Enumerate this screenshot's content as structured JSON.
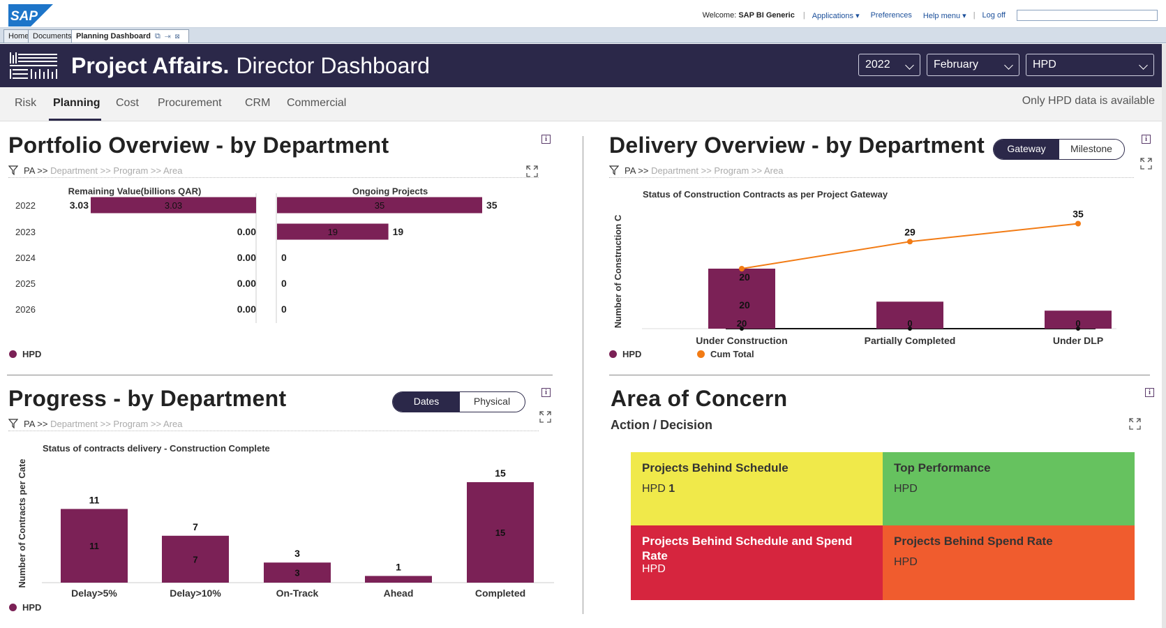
{
  "portal": {
    "logo_text": "SAP",
    "welcome_prefix": "Welcome:",
    "user": "SAP BI Generic",
    "links": [
      "Applications",
      "Preferences",
      "Help menu",
      "Log off"
    ],
    "tabs": [
      "Home",
      "Documents",
      "Planning Dashboard"
    ]
  },
  "header": {
    "title_bold": "Project Affairs.",
    "title_light": "Director Dashboard",
    "year": "2022",
    "month": "February",
    "department": "HPD"
  },
  "nav": {
    "items": [
      "Risk",
      "Planning",
      "Cost",
      "Procurement",
      "CRM",
      "Commercial"
    ],
    "active": "Planning",
    "note": "Only HPD data is available"
  },
  "crumb": {
    "pa": "PA >>",
    "rest": "Department >> Program >> Area"
  },
  "colors": {
    "brand": "#2b2849",
    "bar": "#7b2156",
    "line": "#f27b14",
    "yellow": "#f0e94a",
    "green": "#66c25f",
    "red": "#d6253e",
    "orange": "#f05c2e"
  },
  "portfolio": {
    "title": "Portfolio Overview - by Department",
    "legend": "HPD",
    "chart_data": [
      {
        "type": "bar",
        "title": "Remaining Value(billions QAR)",
        "orientation": "horizontal",
        "categories": [
          "2022",
          "2023",
          "2024",
          "2025",
          "2026"
        ],
        "values": [
          3.03,
          0.0,
          0.0,
          0.0,
          0.0
        ],
        "value_labels": [
          "3.03",
          "0.00",
          "0.00",
          "0.00",
          "0.00"
        ],
        "series": [
          {
            "name": "HPD",
            "values": [
              3.03,
              0.0,
              0.0,
              0.0,
              0.0
            ]
          }
        ]
      },
      {
        "type": "bar",
        "title": "Ongoing Projects",
        "orientation": "horizontal",
        "categories": [
          "2022",
          "2023",
          "2024",
          "2025",
          "2026"
        ],
        "values": [
          35,
          19,
          0,
          0,
          0
        ],
        "series": [
          {
            "name": "HPD",
            "values": [
              35,
              19,
              0,
              0,
              0
            ]
          }
        ]
      }
    ]
  },
  "delivery": {
    "title": "Delivery Overview - by Department",
    "toggle": [
      "Gateway",
      "Milestone"
    ],
    "subtitle": "Status of Construction Contracts as per Project Gateway",
    "ylabel": "Number of Construction C",
    "legend": [
      "HPD",
      "Cum Total"
    ],
    "chart_data": {
      "type": "bar",
      "categories": [
        "Under Construction",
        "Partially Completed",
        "Under DLP"
      ],
      "series": [
        {
          "name": "HPD",
          "values": [
            20,
            9,
            6
          ],
          "labels": [
            "20",
            "0",
            "0"
          ]
        },
        {
          "name": "Cum Total",
          "type": "line",
          "values": [
            20,
            29,
            35
          ],
          "labels": [
            "20",
            "29",
            "35"
          ]
        }
      ],
      "ylim": [
        0,
        40
      ]
    }
  },
  "progress": {
    "title": "Progress - by Department",
    "toggle": [
      "Dates",
      "Physical"
    ],
    "subtitle": "Status of contracts delivery - Construction Complete",
    "ylabel": "Number of Contracts per Cate",
    "legend": "HPD",
    "chart_data": {
      "type": "bar",
      "categories": [
        "Delay>5%",
        "Delay>10%",
        "On-Track",
        "Ahead",
        "Completed"
      ],
      "values": [
        11,
        7,
        3,
        1,
        15
      ],
      "series": [
        {
          "name": "HPD",
          "values": [
            11,
            7,
            3,
            1,
            15
          ]
        }
      ],
      "ylim": [
        0,
        17
      ]
    }
  },
  "concern": {
    "title": "Area of Concern",
    "subtitle": "Action / Decision",
    "cells": [
      {
        "title": "Projects Behind Schedule",
        "dept": "HPD",
        "count": "1"
      },
      {
        "title": "Top Performance",
        "dept": "HPD",
        "count": ""
      },
      {
        "title": "Projects Behind Schedule and Spend Rate",
        "dept": "HPD",
        "count": ""
      },
      {
        "title": "Projects Behind Spend Rate",
        "dept": "HPD",
        "count": ""
      }
    ]
  }
}
